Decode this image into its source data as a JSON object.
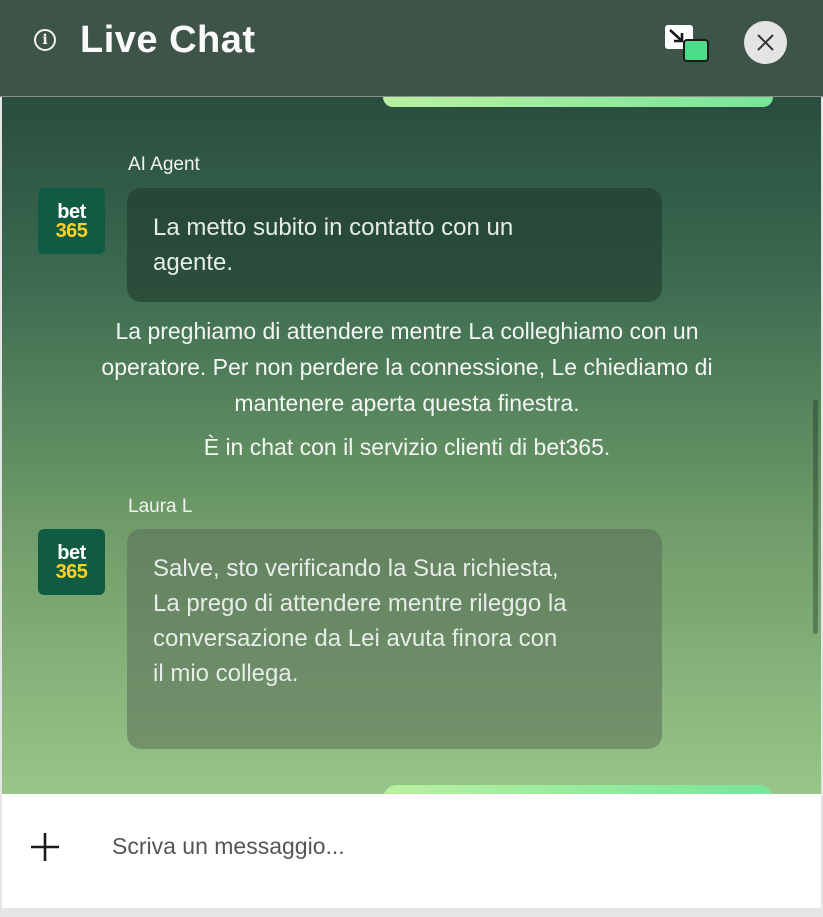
{
  "header": {
    "title": "Live Chat",
    "info_icon": "info-icon",
    "popout_icon": "popout-icon",
    "close_icon": "close-icon"
  },
  "messages": [
    {
      "sender": "AI Agent",
      "avatar": {
        "line1": "bet",
        "line2": "365"
      },
      "text": "La metto subito in contatto con un agente."
    },
    {
      "sender": "Laura L",
      "avatar": {
        "line1": "bet",
        "line2": "365"
      },
      "text": "Salve, sto verificando la Sua richiesta, La prego di attendere mentre rileggo la conversazione da Lei avuta finora con il mio collega."
    }
  ],
  "system_messages": [
    "La preghiamo di attendere mentre La colleghiamo con un operatore. Per non perdere la connessione, Le chiediamo di mantenere aperta questa finestra.",
    "È in chat con il servizio clienti di bet365."
  ],
  "composer": {
    "placeholder": "Scriva un messaggio...",
    "plus_icon": "plus-icon"
  },
  "colors": {
    "header_bg": "#3f5449",
    "brand_green": "#0f5b43",
    "brand_yellow": "#ffd21f",
    "accent_green": "#77e59b"
  }
}
